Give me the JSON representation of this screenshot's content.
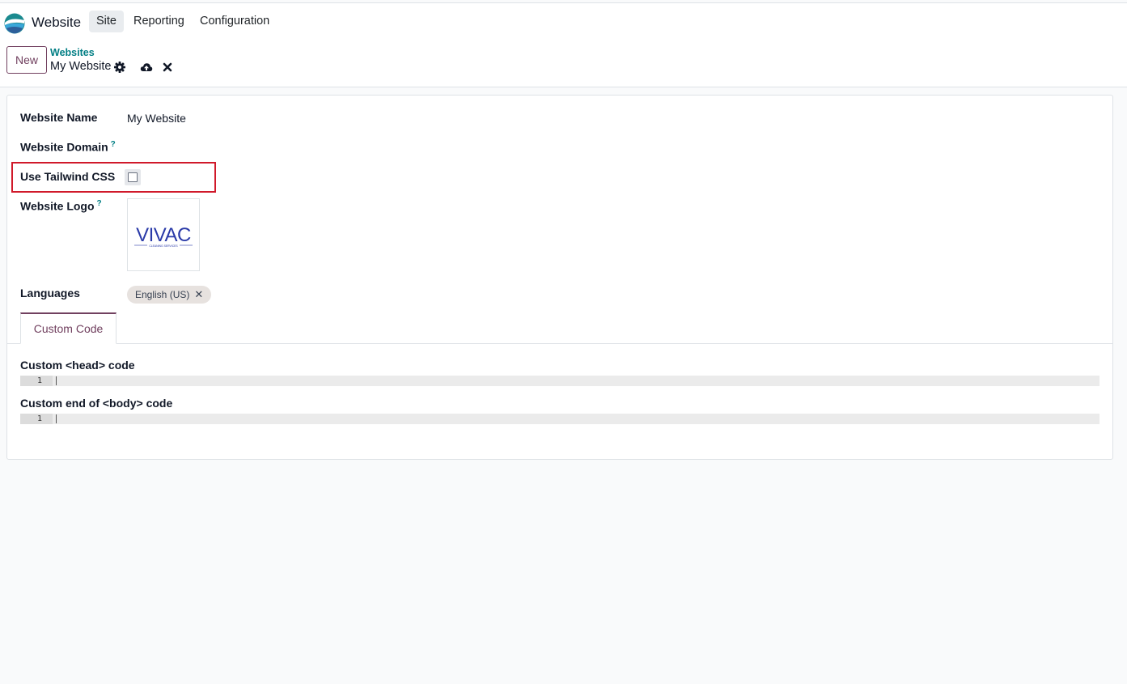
{
  "navbar": {
    "app_name": "Website",
    "menus": [
      "Site",
      "Reporting",
      "Configuration"
    ]
  },
  "control_panel": {
    "new_label": "New",
    "breadcrumb_parent": "Websites",
    "breadcrumb_current": "My Website"
  },
  "form": {
    "website_name_label": "Website Name",
    "website_name_value": "My Website",
    "website_domain_label": "Website Domain",
    "help_mark": "?",
    "tailwind_label": "Use Tailwind CSS",
    "tailwind_checked": false,
    "website_logo_label": "Website Logo",
    "logo_text": "VIVAC",
    "logo_subtext": "CLEANING SERVICES",
    "languages_label": "Languages",
    "language_tag": "English (US)",
    "tag_remove": "✕"
  },
  "tabs": {
    "custom_code": "Custom Code"
  },
  "custom_code": {
    "head_label": "Custom <head> code",
    "body_label": "Custom end of <body> code",
    "line_number": "1"
  },
  "colors": {
    "brand": "#71405f",
    "link": "#017e84",
    "highlight": "#d0192a"
  }
}
